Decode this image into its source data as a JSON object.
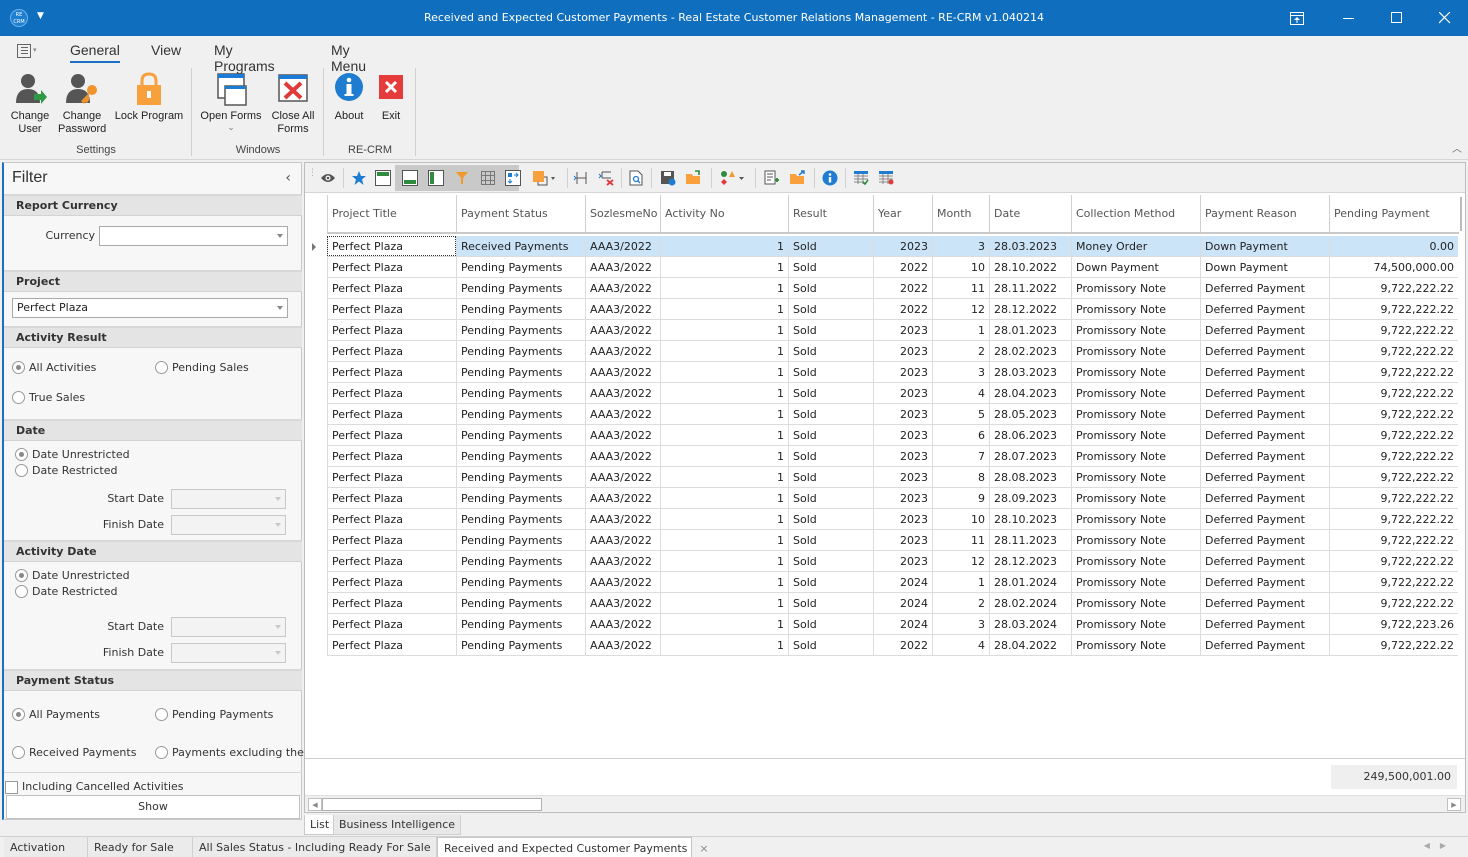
{
  "window": {
    "title": "Received and Expected Customer Payments - Real Estate Customer Relations Management - RE-CRM v1.040214",
    "app_icon_text": "RE CRM",
    "controls": [
      "restore-to-ribbon",
      "minimize",
      "maximize",
      "close"
    ]
  },
  "ribbon": {
    "tabs": [
      {
        "label": "General",
        "active": true
      },
      {
        "label": "View",
        "active": false
      },
      {
        "label": "My Programs",
        "active": false
      },
      {
        "label": "My Menu",
        "active": false
      }
    ],
    "groups": [
      {
        "label": "Settings",
        "buttons": [
          {
            "label_line1": "Change",
            "label_line2": "User",
            "icon": "change-user-icon"
          },
          {
            "label_line1": "Change",
            "label_line2": "Password",
            "icon": "change-password-icon"
          },
          {
            "label_line1": "Lock Program",
            "label_line2": "",
            "icon": "lock-icon"
          }
        ]
      },
      {
        "label": "Windows",
        "buttons": [
          {
            "label_line1": "Open Forms",
            "label_line2": "⌄",
            "icon": "open-forms-icon"
          },
          {
            "label_line1": "Close All",
            "label_line2": "Forms",
            "icon": "close-all-forms-icon"
          }
        ]
      },
      {
        "label": "RE-CRM",
        "buttons": [
          {
            "label_line1": "About",
            "label_line2": "",
            "icon": "info-icon"
          },
          {
            "label_line1": "Exit",
            "label_line2": "",
            "icon": "exit-icon"
          }
        ]
      }
    ]
  },
  "filter": {
    "title": "Filter",
    "report_currency": {
      "heading": "Report Currency",
      "currency_label": "Currency",
      "currency_value": ""
    },
    "project": {
      "heading": "Project",
      "value": "Perfect Plaza"
    },
    "activity_result": {
      "heading": "Activity Result",
      "options": [
        {
          "label": "All Activities",
          "checked": true
        },
        {
          "label": "Pending Sales",
          "checked": false
        },
        {
          "label": "True Sales",
          "checked": false
        }
      ]
    },
    "date": {
      "heading": "Date",
      "options": [
        {
          "label": "Date Unrestricted",
          "checked": true
        },
        {
          "label": "Date Restricted",
          "checked": false
        }
      ],
      "start_label": "Start Date",
      "finish_label": "Finish Date",
      "start_value": "",
      "finish_value": ""
    },
    "activity_date": {
      "heading": "Activity Date",
      "options": [
        {
          "label": "Date Unrestricted",
          "checked": true
        },
        {
          "label": "Date Restricted",
          "checked": false
        }
      ],
      "start_label": "Start Date",
      "finish_label": "Finish Date",
      "start_value": "",
      "finish_value": ""
    },
    "payment_status": {
      "heading": "Payment Status",
      "options": [
        {
          "label": "All Payments",
          "checked": true
        },
        {
          "label": "Pending Payments",
          "checked": false
        },
        {
          "label": "Received Payments",
          "checked": false
        },
        {
          "label": "Payments excluding the",
          "checked": false
        }
      ]
    },
    "including_cancelled": {
      "label": "Including Cancelled Activities",
      "checked": false
    },
    "show_button": "Show"
  },
  "grid": {
    "columns": [
      "Project Title",
      "Payment Status",
      "SozlesmeNo",
      "Activity No",
      "Result",
      "Year",
      "Month",
      "Date",
      "Collection Method",
      "Payment Reason",
      "Pending Payment"
    ],
    "rows": [
      [
        "Perfect Plaza",
        "Received Payments",
        "AAA3/2022",
        "1",
        "Sold",
        "2023",
        "3",
        "28.03.2023",
        "Money Order",
        "Down Payment",
        "0.00"
      ],
      [
        "Perfect Plaza",
        "Pending Payments",
        "AAA3/2022",
        "1",
        "Sold",
        "2022",
        "10",
        "28.10.2022",
        "Down Payment",
        "Down Payment",
        "74,500,000.00"
      ],
      [
        "Perfect Plaza",
        "Pending Payments",
        "AAA3/2022",
        "1",
        "Sold",
        "2022",
        "11",
        "28.11.2022",
        "Promissory Note",
        "Deferred Payment",
        "9,722,222.22"
      ],
      [
        "Perfect Plaza",
        "Pending Payments",
        "AAA3/2022",
        "1",
        "Sold",
        "2022",
        "12",
        "28.12.2022",
        "Promissory Note",
        "Deferred Payment",
        "9,722,222.22"
      ],
      [
        "Perfect Plaza",
        "Pending Payments",
        "AAA3/2022",
        "1",
        "Sold",
        "2023",
        "1",
        "28.01.2023",
        "Promissory Note",
        "Deferred Payment",
        "9,722,222.22"
      ],
      [
        "Perfect Plaza",
        "Pending Payments",
        "AAA3/2022",
        "1",
        "Sold",
        "2023",
        "2",
        "28.02.2023",
        "Promissory Note",
        "Deferred Payment",
        "9,722,222.22"
      ],
      [
        "Perfect Plaza",
        "Pending Payments",
        "AAA3/2022",
        "1",
        "Sold",
        "2023",
        "3",
        "28.03.2023",
        "Promissory Note",
        "Deferred Payment",
        "9,722,222.22"
      ],
      [
        "Perfect Plaza",
        "Pending Payments",
        "AAA3/2022",
        "1",
        "Sold",
        "2023",
        "4",
        "28.04.2023",
        "Promissory Note",
        "Deferred Payment",
        "9,722,222.22"
      ],
      [
        "Perfect Plaza",
        "Pending Payments",
        "AAA3/2022",
        "1",
        "Sold",
        "2023",
        "5",
        "28.05.2023",
        "Promissory Note",
        "Deferred Payment",
        "9,722,222.22"
      ],
      [
        "Perfect Plaza",
        "Pending Payments",
        "AAA3/2022",
        "1",
        "Sold",
        "2023",
        "6",
        "28.06.2023",
        "Promissory Note",
        "Deferred Payment",
        "9,722,222.22"
      ],
      [
        "Perfect Plaza",
        "Pending Payments",
        "AAA3/2022",
        "1",
        "Sold",
        "2023",
        "7",
        "28.07.2023",
        "Promissory Note",
        "Deferred Payment",
        "9,722,222.22"
      ],
      [
        "Perfect Plaza",
        "Pending Payments",
        "AAA3/2022",
        "1",
        "Sold",
        "2023",
        "8",
        "28.08.2023",
        "Promissory Note",
        "Deferred Payment",
        "9,722,222.22"
      ],
      [
        "Perfect Plaza",
        "Pending Payments",
        "AAA3/2022",
        "1",
        "Sold",
        "2023",
        "9",
        "28.09.2023",
        "Promissory Note",
        "Deferred Payment",
        "9,722,222.22"
      ],
      [
        "Perfect Plaza",
        "Pending Payments",
        "AAA3/2022",
        "1",
        "Sold",
        "2023",
        "10",
        "28.10.2023",
        "Promissory Note",
        "Deferred Payment",
        "9,722,222.22"
      ],
      [
        "Perfect Plaza",
        "Pending Payments",
        "AAA3/2022",
        "1",
        "Sold",
        "2023",
        "11",
        "28.11.2023",
        "Promissory Note",
        "Deferred Payment",
        "9,722,222.22"
      ],
      [
        "Perfect Plaza",
        "Pending Payments",
        "AAA3/2022",
        "1",
        "Sold",
        "2023",
        "12",
        "28.12.2023",
        "Promissory Note",
        "Deferred Payment",
        "9,722,222.22"
      ],
      [
        "Perfect Plaza",
        "Pending Payments",
        "AAA3/2022",
        "1",
        "Sold",
        "2024",
        "1",
        "28.01.2024",
        "Promissory Note",
        "Deferred Payment",
        "9,722,222.22"
      ],
      [
        "Perfect Plaza",
        "Pending Payments",
        "AAA3/2022",
        "1",
        "Sold",
        "2024",
        "2",
        "28.02.2024",
        "Promissory Note",
        "Deferred Payment",
        "9,722,222.22"
      ],
      [
        "Perfect Plaza",
        "Pending Payments",
        "AAA3/2022",
        "1",
        "Sold",
        "2024",
        "3",
        "28.03.2024",
        "Promissory Note",
        "Deferred Payment",
        "9,722,223.26"
      ],
      [
        "Perfect Plaza",
        "Pending Payments",
        "AAA3/2022",
        "1",
        "Sold",
        "2022",
        "4",
        "28.04.2022",
        "Promissory Note",
        "Deferred Payment",
        "9,722,222.22"
      ]
    ],
    "selected_row": 0,
    "total_pending_payment": "249,500,001.00"
  },
  "toolbar": {
    "icons": [
      "eye-icon",
      "favorite-star-icon",
      "group-panel-icon",
      "footer-panel-icon",
      "column-panel-icon",
      "filter-icon",
      "grid-lines-icon",
      "move-columns-icon",
      "color-format-icon",
      "best-fit-columns-icon",
      "remove-columns-icon",
      "print-preview-icon",
      "save-layout-icon",
      "load-layout-icon",
      "conditional-format-icon",
      "export-icon",
      "open-export-icon",
      "info-icon",
      "layout-apply-icon",
      "layout-reset-icon"
    ]
  },
  "view_tabs": [
    {
      "label": "List",
      "active": true
    },
    {
      "label": "Business Intelligence",
      "active": false
    }
  ],
  "doc_tabs": [
    {
      "label": "Activation",
      "active": false
    },
    {
      "label": "Ready for Sale",
      "active": false
    },
    {
      "label": "All Sales Status - Including Ready For Sale",
      "active": false
    },
    {
      "label": "Received and Expected Customer Payments",
      "active": true,
      "close": "×"
    }
  ],
  "colors": {
    "titlebar": "#106ebe",
    "accent": "#1c6fc4",
    "selection": "#cce4f7"
  }
}
